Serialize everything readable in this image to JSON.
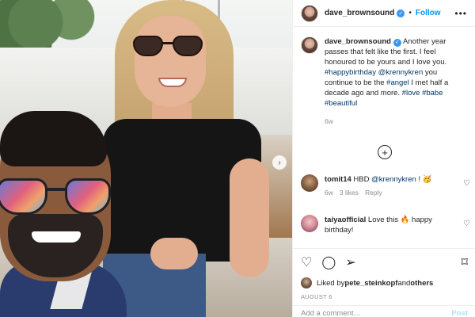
{
  "header": {
    "username": "dave_brownsound",
    "separator": "•",
    "follow_label": "Follow",
    "more_icon": "more-horizontal-icon"
  },
  "caption": {
    "username": "dave_brownsound",
    "text_1": " Another year passes that felt like the first. I feel honoured to be yours and I love you. ",
    "tag_1": "#happybirthday",
    "mention_1": "@krennykren",
    "text_2": " you continue to be the ",
    "tag_2": "#angel",
    "text_3": " I met half a decade ago and more. ",
    "tag_3": "#love",
    "tag_4": "#babe",
    "tag_5": "#beautiful",
    "age": "6w"
  },
  "comments": [
    {
      "username": "tomit14",
      "text_prefix": " HBD ",
      "mention": "@krennykren",
      "text_suffix": " ! 🥳",
      "age": "6w",
      "likes": "3 likes",
      "reply": "Reply"
    },
    {
      "username": "taiyaofficial",
      "text": " Love this 🔥 happy birthday!"
    }
  ],
  "actions": {
    "liked_prefix": "Liked by ",
    "liked_user": "pete_steinkopf",
    "liked_suffix": " and ",
    "liked_others": "others",
    "date": "AUGUST 6"
  },
  "add_comment": {
    "placeholder": "Add a comment…",
    "post_label": "Post"
  },
  "colors": {
    "link_blue": "#0095f6",
    "hashtag": "#00376b",
    "verified_badge": "#3897f0",
    "muted": "#8e8e8e"
  }
}
